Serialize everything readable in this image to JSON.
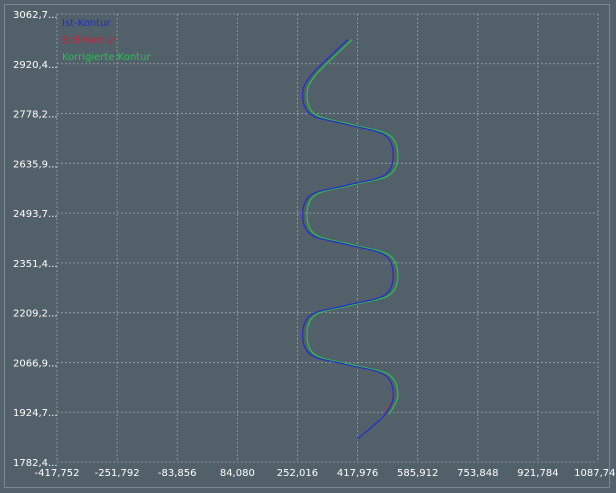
{
  "chart_data": {
    "type": "line",
    "title": "",
    "xlabel": "",
    "ylabel": "",
    "xlim": [
      -417.752,
      1087.744
    ],
    "ylim": [
      1782.4,
      3062.7
    ],
    "x_ticks": [
      "-417,752",
      "-251,792",
      "-83,856",
      "84,080",
      "252,016",
      "417,976",
      "585,912",
      "753,848",
      "921,784",
      "1087,744"
    ],
    "y_ticks": [
      "3062,7...",
      "2920,4...",
      "2778,2...",
      "2635,9...",
      "2493,7...",
      "2351,4...",
      "2209,2...",
      "2066,9...",
      "1924,7...",
      "1782,4..."
    ],
    "grid": true,
    "legend_position": "top-left",
    "series": [
      {
        "name": "Ist-Kontur",
        "color": "#1e2fd6",
        "x": [
          418,
          494,
          518,
          494,
          392,
          290,
          266,
          290,
          392,
          494,
          518,
          494,
          392,
          290,
          266,
          290,
          392,
          494,
          518,
          494,
          392,
          290,
          266,
          290,
          392
        ],
        "y": [
          1848,
          1917,
          1973,
          2032,
          2060,
          2088,
          2145,
          2203,
          2231,
          2259,
          2316,
          2374,
          2403,
          2432,
          2488,
          2546,
          2574,
          2602,
          2659,
          2717,
          2746,
          2775,
          2831,
          2888,
          2990
        ]
      },
      {
        "name": "Soll-Kontur",
        "color": "#d61e3a",
        "x": [
          494,
          518,
          494,
          392,
          290,
          266,
          290,
          392,
          494,
          518,
          494,
          392,
          290,
          266,
          290,
          392,
          494,
          518,
          494,
          392,
          290,
          266,
          290,
          392
        ],
        "y": [
          1917,
          1973,
          2032,
          2060,
          2088,
          2145,
          2203,
          2231,
          2259,
          2316,
          2374,
          2403,
          2432,
          2488,
          2546,
          2574,
          2602,
          2659,
          2717,
          2746,
          2775,
          2831,
          2888,
          2990
        ]
      },
      {
        "name": "Korrigierte Kontur",
        "color": "#1ec84a",
        "x": [
          506,
          531,
          506,
          404,
          302,
          278,
          302,
          404,
          506,
          531,
          506,
          404,
          302,
          278,
          302,
          404,
          506,
          531,
          506,
          404,
          302,
          278,
          302,
          404
        ],
        "y": [
          1917,
          1973,
          2032,
          2060,
          2088,
          2145,
          2203,
          2231,
          2259,
          2316,
          2374,
          2403,
          2432,
          2488,
          2546,
          2574,
          2602,
          2659,
          2717,
          2746,
          2775,
          2831,
          2888,
          2990
        ]
      }
    ]
  }
}
